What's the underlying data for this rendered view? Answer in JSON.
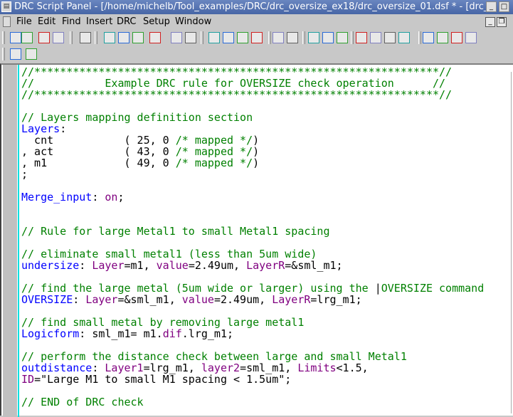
{
  "window": {
    "title": "DRC Script Panel - [/home/michelb/Tool_examples/DRC/drc_oversize_ex18/drc_oversize_01.dsf * - [drc_",
    "minimize": "_",
    "maximize": "□"
  },
  "menu": {
    "items": [
      "File",
      "Edit",
      "Find",
      "Insert",
      "DRC",
      "Setup",
      "Window"
    ],
    "mdi_minimize": "_",
    "mdi_restore": "❐"
  },
  "toolbar1": {
    "icons": [
      "new-file-icon",
      "open-file-icon",
      "save-icon",
      "save-all-icon",
      "print-icon",
      "run-icon",
      "run-rule-icon",
      "run-selected-icon",
      "layout-icon",
      "zoom-in-icon",
      "zoom-out-icon",
      "layer-map-icon",
      "rule-icon",
      "check-icon",
      "spacing-icon",
      "frame-icon",
      "edit-icon",
      "help-icon",
      "copy-disabled-icon",
      "copy-icon",
      "paste-icon",
      "find-icon",
      "find-next-icon",
      "find-prev-icon",
      "replace-icon",
      "bookmark-icon",
      "bookmark-next-icon",
      "bookmark-prev-icon"
    ]
  },
  "toolbar2": {
    "icons": [
      "fit-icon",
      "script-edit-icon"
    ]
  },
  "colors": {
    "comment": "#008000",
    "keyword": "#0000ff",
    "parameter": "#800080",
    "text": "#000000"
  },
  "code": [
    [
      [
        "//***************************************************************//",
        "c"
      ]
    ],
    [
      [
        "//           Example DRC rule for OVERSIZE check operation      //",
        "c"
      ]
    ],
    [
      [
        "//***************************************************************//",
        "c"
      ]
    ],
    [],
    [
      [
        "// Layers mapping definition section",
        "c"
      ]
    ],
    [
      [
        "Layers",
        "k"
      ],
      [
        ":",
        "t"
      ]
    ],
    [
      [
        "  cnt           ( 25, 0 ",
        "t"
      ],
      [
        "/* mapped */",
        "c"
      ],
      [
        ")",
        "t"
      ]
    ],
    [
      [
        ", act           ( 43, 0 ",
        "t"
      ],
      [
        "/* mapped */",
        "c"
      ],
      [
        ")",
        "t"
      ]
    ],
    [
      [
        ", m1            ( 49, 0 ",
        "t"
      ],
      [
        "/* mapped */",
        "c"
      ],
      [
        ")",
        "t"
      ]
    ],
    [
      [
        ";",
        "t"
      ]
    ],
    [],
    [
      [
        "Merge_input",
        "k"
      ],
      [
        ": ",
        "t"
      ],
      [
        "on",
        "p"
      ],
      [
        ";",
        "t"
      ]
    ],
    [],
    [],
    [
      [
        "// Rule for large Metal1 to small Metal1 spacing",
        "c"
      ]
    ],
    [],
    [
      [
        "// eliminate small metal1 (less than 5um wide)",
        "c"
      ]
    ],
    [
      [
        "undersize",
        "k"
      ],
      [
        ": ",
        "t"
      ],
      [
        "Layer",
        "p"
      ],
      [
        "=m1, ",
        "t"
      ],
      [
        "value",
        "p"
      ],
      [
        "=2.49um, ",
        "t"
      ],
      [
        "LayerR",
        "p"
      ],
      [
        "=&sml_m1;",
        "t"
      ]
    ],
    [],
    [
      [
        "// find the large metal (5um wide or larger) using the ",
        "c"
      ],
      [
        "|",
        "t"
      ],
      [
        "OVERSIZE command",
        "c"
      ]
    ],
    [
      [
        "OVERSIZE",
        "k"
      ],
      [
        ": ",
        "t"
      ],
      [
        "Layer",
        "p"
      ],
      [
        "=&sml_m1, ",
        "t"
      ],
      [
        "value",
        "p"
      ],
      [
        "=2.49um, ",
        "t"
      ],
      [
        "LayerR",
        "p"
      ],
      [
        "=lrg_m1;",
        "t"
      ]
    ],
    [],
    [
      [
        "// find small metal by removing large metal1",
        "c"
      ]
    ],
    [
      [
        "Logicform",
        "k"
      ],
      [
        ": sml_m1= m1.",
        "t"
      ],
      [
        "dif",
        "p"
      ],
      [
        ".lrg_m1;",
        "t"
      ]
    ],
    [],
    [
      [
        "// perform the distance check between large and small Metal1",
        "c"
      ]
    ],
    [
      [
        "outdistance",
        "k"
      ],
      [
        ": ",
        "t"
      ],
      [
        "Layer1",
        "p"
      ],
      [
        "=lrg_m1, ",
        "t"
      ],
      [
        "layer2",
        "p"
      ],
      [
        "=sml_m1, ",
        "t"
      ],
      [
        "Limits",
        "p"
      ],
      [
        "<1.5,",
        "t"
      ]
    ],
    [
      [
        "ID",
        "p"
      ],
      [
        "=\"Large M1 to small M1 spacing < 1.5um\";",
        "t"
      ]
    ],
    [],
    [
      [
        "// END of DRC check",
        "c"
      ]
    ]
  ]
}
